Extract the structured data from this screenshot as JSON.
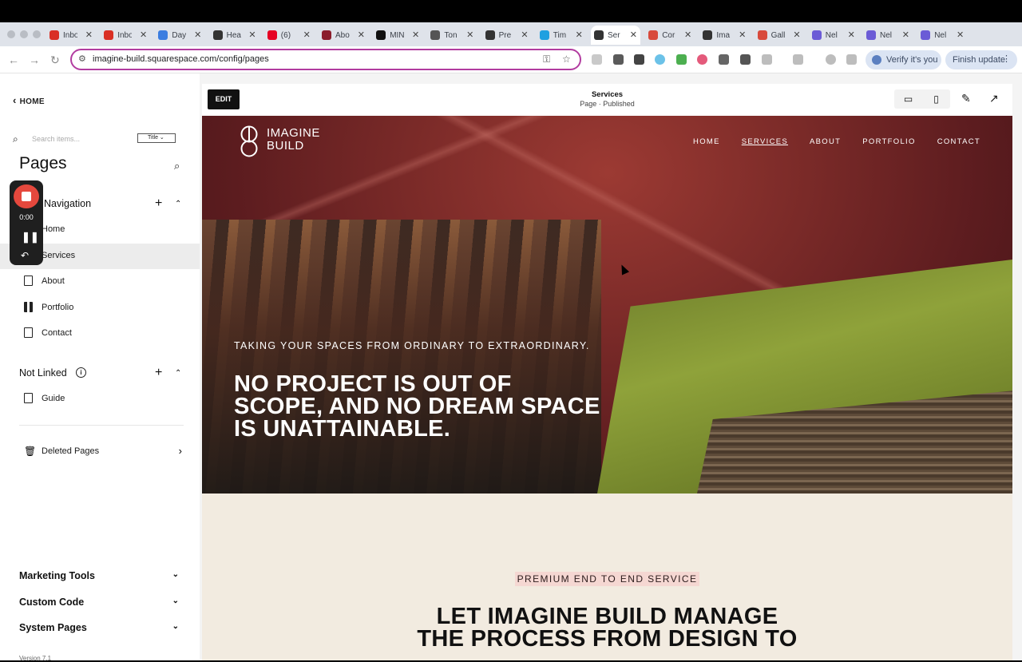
{
  "browser": {
    "tabs": [
      {
        "title": "Inbo",
        "fav_color": "#d93025"
      },
      {
        "title": "Inbo",
        "fav_color": "#d93025"
      },
      {
        "title": "Day",
        "fav_color": "#3b7de0"
      },
      {
        "title": "Hea",
        "fav_color": "#333333"
      },
      {
        "title": "(6)",
        "fav_color": "#e60023"
      },
      {
        "title": "Abo",
        "fav_color": "#8b1d2c"
      },
      {
        "title": "MIN",
        "fav_color": "#111111"
      },
      {
        "title": "Ton",
        "fav_color": "#555555"
      },
      {
        "title": "Pre",
        "fav_color": "#333333"
      },
      {
        "title": "Tim",
        "fav_color": "#1fa0e0"
      },
      {
        "title": "Ser",
        "fav_color": "#333333"
      },
      {
        "title": "Cor",
        "fav_color": "#d84a3c"
      },
      {
        "title": "Ima",
        "fav_color": "#333333"
      },
      {
        "title": "Gall",
        "fav_color": "#d84a3c"
      },
      {
        "title": "Nel",
        "fav_color": "#6b5bd6"
      },
      {
        "title": "Nel",
        "fav_color": "#6b5bd6"
      },
      {
        "title": "Nel",
        "fav_color": "#6b5bd6"
      }
    ],
    "active_tab_index": 10,
    "close_glyph": "✕",
    "new_tab": "+",
    "url": "imagine-build.squarespace.com/config/pages",
    "verify_label": "Verify it's you",
    "finish_label": "Finish update"
  },
  "sidebar": {
    "back_label": "HOME",
    "search_placeholder": "Search items...",
    "sort_select": "Title",
    "title": "Pages",
    "navigation": {
      "label": "Navigation",
      "items": [
        {
          "label": "Home"
        },
        {
          "label": "Services"
        },
        {
          "label": "About"
        },
        {
          "label": "Portfolio"
        },
        {
          "label": "Contact"
        }
      ]
    },
    "not_linked": {
      "label": "Not Linked",
      "items": [
        {
          "label": "Guide"
        }
      ]
    },
    "deleted_pages": "Deleted Pages",
    "bottom_sections": [
      "Marketing Tools",
      "Custom Code",
      "System Pages"
    ],
    "version": "Version 7.1"
  },
  "recorder": {
    "time": "0:00"
  },
  "editor": {
    "edit_label": "EDIT",
    "page_name": "Services",
    "page_status": "Page · Published"
  },
  "site": {
    "logo_line1": "IMAGINE",
    "logo_line2": "BUILD",
    "nav": [
      "HOME",
      "SERVICES",
      "ABOUT",
      "PORTFOLIO",
      "CONTACT"
    ],
    "nav_current": "SERVICES",
    "hero_kicker": "TAKING YOUR SPACES FROM ORDINARY TO EXTRAORDINARY.",
    "hero_title": "NO PROJECT IS OUT OF SCOPE, AND NO DREAM SPACE IS UNATTAINABLE.",
    "section_kicker": "PREMIUM END TO END SERVICE",
    "section_headline_1": "LET IMAGINE BUILD MANAGE",
    "section_headline_2": "THE PROCESS FROM DESIGN TO"
  },
  "colors": {
    "accent_url_border": "#b23ca0",
    "recorder_red": "#e5483d",
    "section_bg": "#f2ebe0",
    "kicker_highlight": "#f5d7d2"
  }
}
